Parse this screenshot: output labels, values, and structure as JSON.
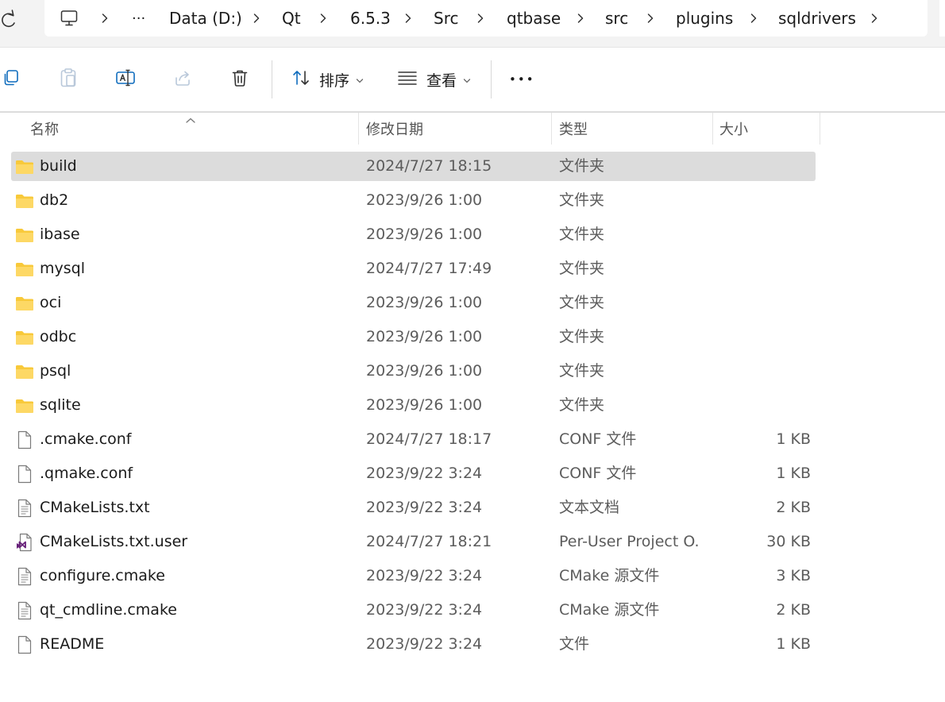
{
  "address_bar": {
    "overflow": "···",
    "segments": [
      "Data (D:)",
      "Qt",
      "6.5.3",
      "Src",
      "qtbase",
      "src",
      "plugins",
      "sqldrivers"
    ]
  },
  "toolbar": {
    "sort_label": "排序",
    "view_label": "查看",
    "more_label": "•••"
  },
  "columns": {
    "name": "名称",
    "date": "修改日期",
    "type": "类型",
    "size": "大小",
    "sort_indicator": "^"
  },
  "colors": {
    "folder": "#f8c93a",
    "selected_row": "#dcdcdc",
    "vs_icon": "#68217a"
  },
  "files": [
    {
      "name": "build",
      "date": "2024/7/27 18:15",
      "type": "文件夹",
      "size": "",
      "icon": "folder-icon",
      "selected": true
    },
    {
      "name": "db2",
      "date": "2023/9/26 1:00",
      "type": "文件夹",
      "size": "",
      "icon": "folder-icon"
    },
    {
      "name": "ibase",
      "date": "2023/9/26 1:00",
      "type": "文件夹",
      "size": "",
      "icon": "folder-icon"
    },
    {
      "name": "mysql",
      "date": "2024/7/27 17:49",
      "type": "文件夹",
      "size": "",
      "icon": "folder-icon"
    },
    {
      "name": "oci",
      "date": "2023/9/26 1:00",
      "type": "文件夹",
      "size": "",
      "icon": "folder-icon"
    },
    {
      "name": "odbc",
      "date": "2023/9/26 1:00",
      "type": "文件夹",
      "size": "",
      "icon": "folder-icon"
    },
    {
      "name": "psql",
      "date": "2023/9/26 1:00",
      "type": "文件夹",
      "size": "",
      "icon": "folder-icon"
    },
    {
      "name": "sqlite",
      "date": "2023/9/26 1:00",
      "type": "文件夹",
      "size": "",
      "icon": "folder-icon"
    },
    {
      "name": ".cmake.conf",
      "date": "2024/7/27 18:17",
      "type": "CONF 文件",
      "size": "1 KB",
      "icon": "file-icon"
    },
    {
      "name": ".qmake.conf",
      "date": "2023/9/22 3:24",
      "type": "CONF 文件",
      "size": "1 KB",
      "icon": "file-icon"
    },
    {
      "name": "CMakeLists.txt",
      "date": "2023/9/22 3:24",
      "type": "文本文档",
      "size": "2 KB",
      "icon": "text-file-icon"
    },
    {
      "name": "CMakeLists.txt.user",
      "date": "2024/7/27 18:21",
      "type": "Per-User Project O...",
      "size": "30 KB",
      "icon": "visual-studio-file-icon"
    },
    {
      "name": "configure.cmake",
      "date": "2023/9/22 3:24",
      "type": "CMake 源文件",
      "size": "3 KB",
      "icon": "text-file-icon"
    },
    {
      "name": "qt_cmdline.cmake",
      "date": "2023/9/22 3:24",
      "type": "CMake 源文件",
      "size": "2 KB",
      "icon": "text-file-icon"
    },
    {
      "name": "README",
      "date": "2023/9/22 3:24",
      "type": "文件",
      "size": "1 KB",
      "icon": "file-icon"
    }
  ]
}
